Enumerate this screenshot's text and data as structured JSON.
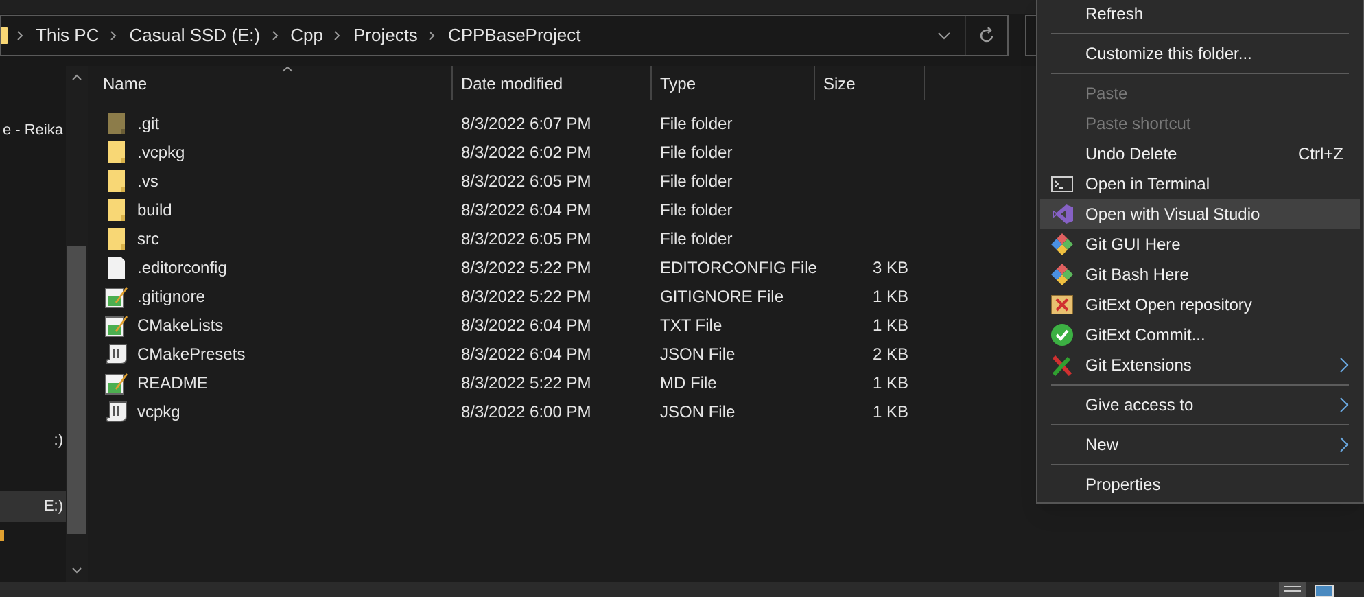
{
  "breadcrumb": [
    "This PC",
    "Casual SSD (E:)",
    "Cpp",
    "Projects",
    "CPPBaseProject"
  ],
  "sidebar": {
    "items": [
      {
        "label": "e - Reika",
        "selected": false
      },
      {
        "label": ":)",
        "selected": false
      },
      {
        "label": "E:)",
        "selected": true
      }
    ]
  },
  "table": {
    "columns": [
      "Name",
      "Date modified",
      "Type",
      "Size"
    ],
    "rows": [
      {
        "kind": "folder_hidden",
        "name": ".git",
        "date": "8/3/2022 6:07 PM",
        "type": "File folder"
      },
      {
        "kind": "folder",
        "name": ".vcpkg",
        "date": "8/3/2022 6:02 PM",
        "type": "File folder"
      },
      {
        "kind": "folder",
        "name": ".vs",
        "date": "8/3/2022 6:05 PM",
        "type": "File folder"
      },
      {
        "kind": "folder",
        "name": "build",
        "date": "8/3/2022 6:04 PM",
        "type": "File folder"
      },
      {
        "kind": "folder",
        "name": "src",
        "date": "8/3/2022 6:05 PM",
        "type": "File folder"
      },
      {
        "kind": "file",
        "name": ".editorconfig",
        "date": "8/3/2022 5:22 PM",
        "type": "EDITORCONFIG File",
        "size": "3 KB"
      },
      {
        "kind": "text",
        "name": ".gitignore",
        "date": "8/3/2022 5:22 PM",
        "type": "GITIGNORE File",
        "size": "1 KB"
      },
      {
        "kind": "text",
        "name": "CMakeLists",
        "date": "8/3/2022 6:04 PM",
        "type": "TXT File",
        "size": "1 KB"
      },
      {
        "kind": "script",
        "name": "CMakePresets",
        "date": "8/3/2022 6:04 PM",
        "type": "JSON File",
        "size": "2 KB"
      },
      {
        "kind": "text",
        "name": "README",
        "date": "8/3/2022 5:22 PM",
        "type": "MD File",
        "size": "1 KB"
      },
      {
        "kind": "script",
        "name": "vcpkg",
        "date": "8/3/2022 6:00 PM",
        "type": "JSON File",
        "size": "1 KB"
      }
    ]
  },
  "context_menu": {
    "items": [
      {
        "kind": "item",
        "label": "Refresh",
        "submenu": false,
        "disabled": false,
        "selected": false
      },
      {
        "kind": "separator"
      },
      {
        "kind": "item",
        "label": "Customize this folder...",
        "submenu": false,
        "disabled": false,
        "selected": false
      },
      {
        "kind": "separator"
      },
      {
        "kind": "item",
        "label": "Paste",
        "submenu": false,
        "disabled": true,
        "selected": false
      },
      {
        "kind": "item",
        "label": "Paste shortcut",
        "submenu": false,
        "disabled": true,
        "selected": false
      },
      {
        "kind": "item",
        "label": "Undo Delete",
        "shortcut": "Ctrl+Z",
        "submenu": false,
        "disabled": false,
        "selected": false
      },
      {
        "kind": "terminal",
        "label": "Open in Terminal",
        "submenu": false,
        "disabled": false,
        "selected": false
      },
      {
        "kind": "vs",
        "label": "Open with Visual Studio",
        "submenu": false,
        "disabled": false,
        "selected": true
      },
      {
        "kind": "git",
        "label": "Git GUI Here",
        "submenu": false,
        "disabled": false,
        "selected": false
      },
      {
        "kind": "git",
        "label": "Git Bash Here",
        "submenu": false,
        "disabled": false,
        "selected": false
      },
      {
        "kind": "repo",
        "label": "GitExt Open repository",
        "submenu": false,
        "disabled": false,
        "selected": false
      },
      {
        "kind": "check",
        "label": "GitExt Commit...",
        "submenu": false,
        "disabled": false,
        "selected": false
      },
      {
        "kind": "gitext",
        "label": "Git Extensions",
        "submenu": true,
        "disabled": false,
        "selected": false
      },
      {
        "kind": "separator"
      },
      {
        "kind": "item",
        "label": "Give access to",
        "submenu": true,
        "disabled": false,
        "selected": false
      },
      {
        "kind": "separator"
      },
      {
        "kind": "item",
        "label": "New",
        "submenu": true,
        "disabled": false,
        "selected": false
      },
      {
        "kind": "separator"
      },
      {
        "kind": "item",
        "label": "Properties",
        "submenu": false,
        "disabled": false,
        "selected": false
      }
    ]
  }
}
